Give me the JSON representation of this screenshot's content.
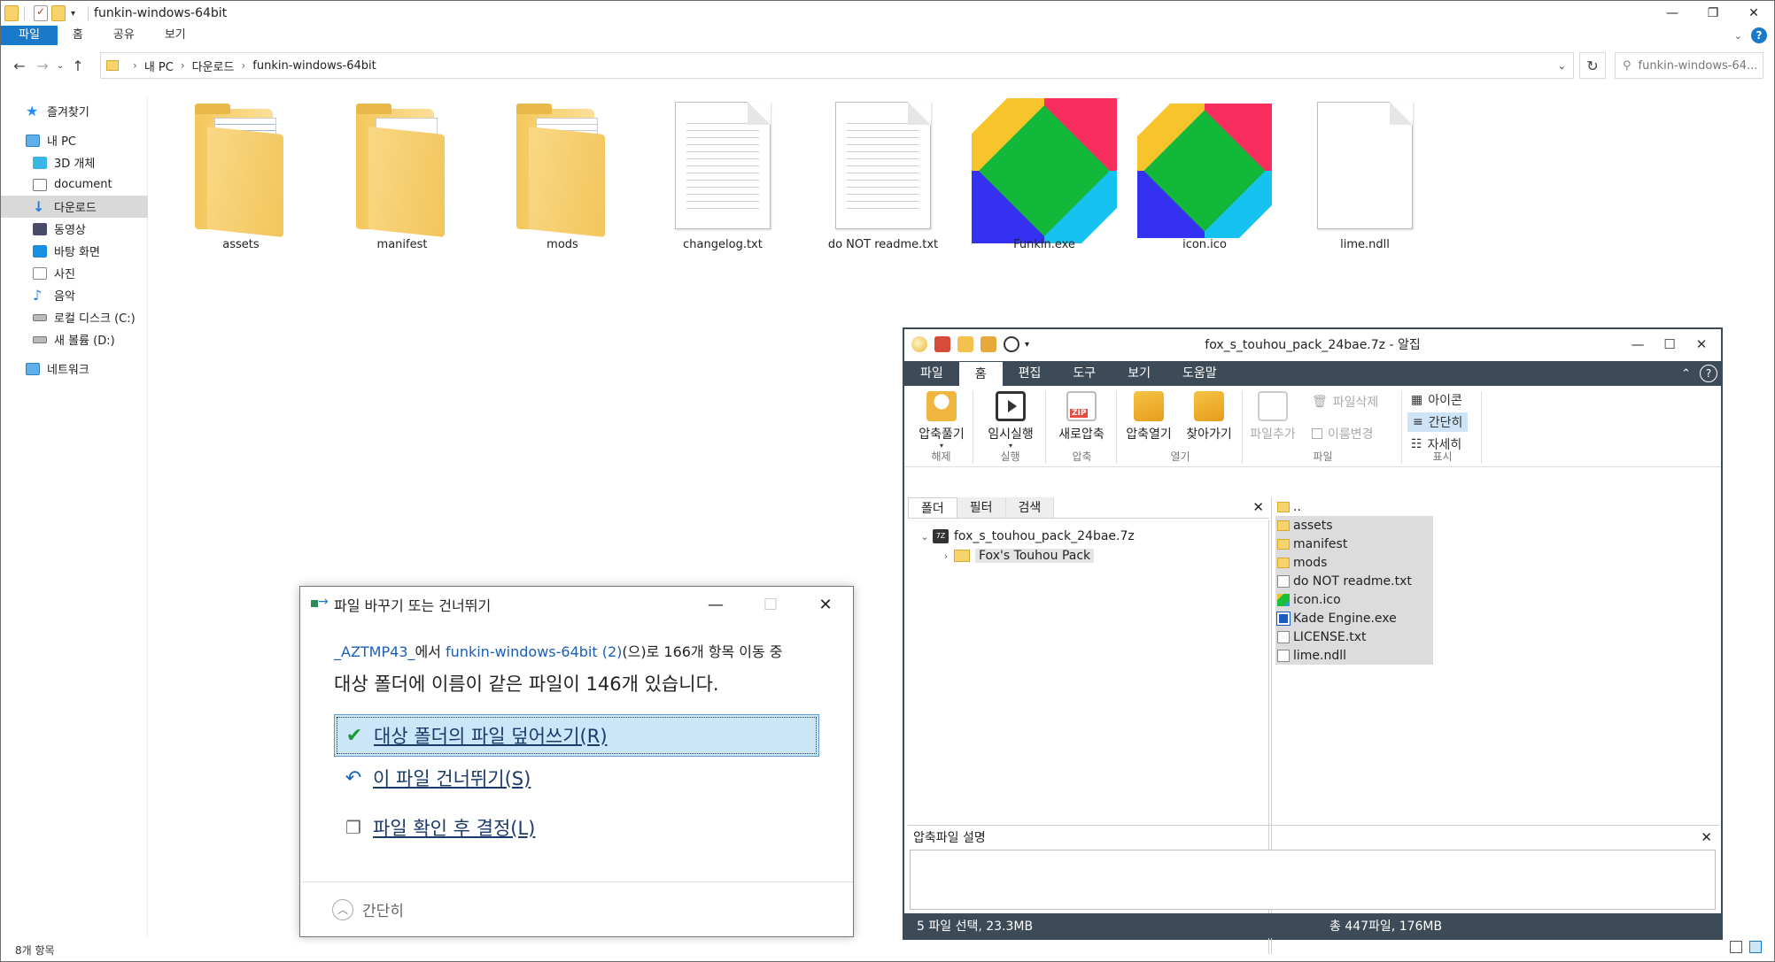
{
  "explorer": {
    "title": "funkin-windows-64bit",
    "tabs": [
      "파일",
      "홈",
      "공유",
      "보기"
    ],
    "address": {
      "crumbs": [
        "내 PC",
        "다운로드",
        "funkin-windows-64bit"
      ]
    },
    "search_placeholder": "funkin-windows-64...",
    "nav": [
      {
        "label": "즐겨찾기",
        "icon": "star-icon"
      },
      {
        "label": "내 PC",
        "icon": "pc-icon"
      },
      {
        "label": "3D 개체",
        "icon": "cube-icon"
      },
      {
        "label": "document",
        "icon": "document-icon"
      },
      {
        "label": "다운로드",
        "icon": "download-icon",
        "selected": true
      },
      {
        "label": "동영상",
        "icon": "video-icon"
      },
      {
        "label": "바탕 화면",
        "icon": "desktop-icon"
      },
      {
        "label": "사진",
        "icon": "picture-icon"
      },
      {
        "label": "음악",
        "icon": "music-icon"
      },
      {
        "label": "로컬 디스크 (C:)",
        "icon": "disk-icon"
      },
      {
        "label": "새 볼륨 (D:)",
        "icon": "disk-icon"
      },
      {
        "label": "네트워크",
        "icon": "network-icon"
      }
    ],
    "files": [
      {
        "name": "assets",
        "type": "folder"
      },
      {
        "name": "manifest",
        "type": "folder"
      },
      {
        "name": "mods",
        "type": "folder"
      },
      {
        "name": "changelog.txt",
        "type": "text"
      },
      {
        "name": "do NOT readme.txt",
        "type": "text"
      },
      {
        "name": "Funkin.exe",
        "type": "exe"
      },
      {
        "name": "icon.ico",
        "type": "ico"
      },
      {
        "name": "lime.ndll",
        "type": "blank"
      }
    ],
    "status": "8개 항목"
  },
  "alzip": {
    "title": "fox_s_touhou_pack_24bae.7z - 알집",
    "tabs": [
      "파일",
      "홈",
      "편집",
      "도구",
      "보기",
      "도움말"
    ],
    "ribbon": {
      "extract": "압축풀기",
      "extract_group": "해제",
      "run": "임시실행",
      "run_group": "실행",
      "new": "새로압축",
      "new_group": "압축",
      "open": "압축열기",
      "goto": "찾아가기",
      "open_group": "열기",
      "add_file": "파일추가",
      "delete_file": "파일삭제",
      "rename": "이름변경",
      "file_group": "파일",
      "view_icon": "아이콘",
      "view_simple": "간단히",
      "view_detail": "자세히",
      "view_group": "표시"
    },
    "left_tabs": [
      "폴더",
      "필터",
      "검색"
    ],
    "tree": {
      "root": "fox_s_touhou_pack_24bae.7z",
      "child": "Fox's Touhou Pack"
    },
    "file_list": [
      {
        "name": "..",
        "kind": "folder",
        "selected": false
      },
      {
        "name": "assets",
        "kind": "folder",
        "selected": true
      },
      {
        "name": "manifest",
        "kind": "folder",
        "selected": true
      },
      {
        "name": "mods",
        "kind": "folder",
        "selected": true
      },
      {
        "name": "do NOT readme.txt",
        "kind": "doc",
        "selected": true
      },
      {
        "name": "icon.ico",
        "kind": "ico",
        "selected": true
      },
      {
        "name": "Kade Engine.exe",
        "kind": "exe",
        "selected": true
      },
      {
        "name": "LICENSE.txt",
        "kind": "doc",
        "selected": true
      },
      {
        "name": "lime.ndll",
        "kind": "doc",
        "selected": true
      }
    ],
    "desc_title": "압축파일 설명",
    "status_left": "5 파일 선택,  23.3MB",
    "status_right": "총 447파일,  176MB"
  },
  "replace_dialog": {
    "title": "파일 바꾸기 또는 건너뛰기",
    "source": "_AZTMP43_",
    "from_text": "에서",
    "dest": "funkin-windows-64bit (2)",
    "move_text": "(으)로 166개 항목 이동 중",
    "message": "대상 폴더에 이름이 같은 파일이 146개 있습니다.",
    "opt_replace": "대상 폴더의 파일 덮어쓰기(R)",
    "opt_skip": "이 파일 건너뛰기(S)",
    "opt_decide": "파일 확인 후 결정(L)",
    "footer": "간단히"
  }
}
